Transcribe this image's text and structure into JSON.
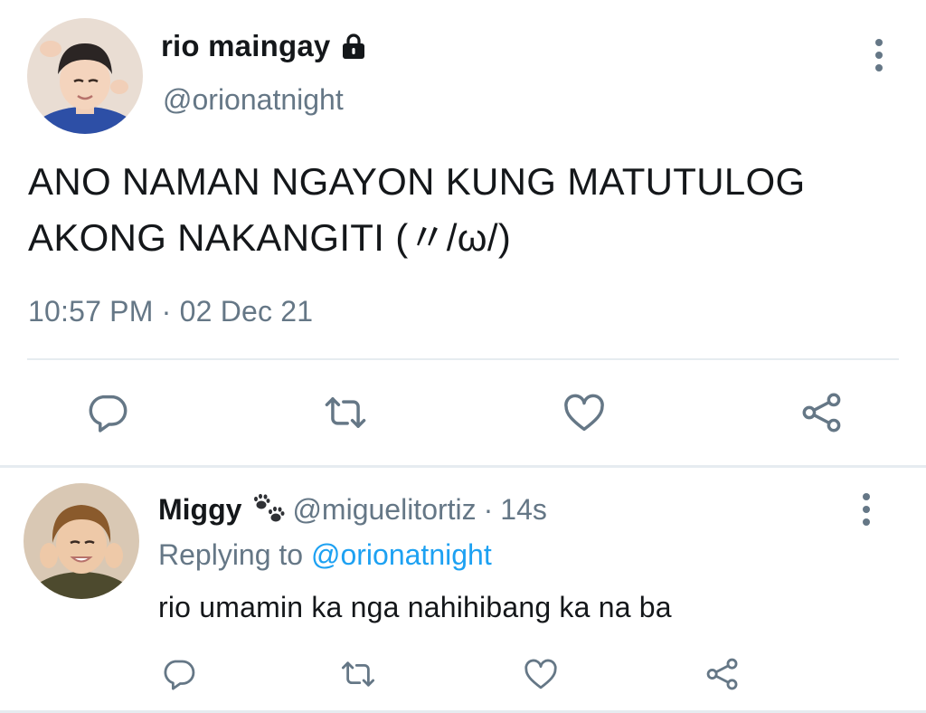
{
  "tweet": {
    "author_name": "rio maingay",
    "handle": "@orionatnight",
    "text": "ANO NAMAN NGAYON KUNG MATUTULOG AKONG NAKANGITI (〃/ω/)",
    "time": "10:57 PM",
    "separator": "·",
    "date": "02 Dec 21",
    "protected": true,
    "icons": [
      "lock-icon",
      "more-options-icon",
      "reply-icon",
      "retweet-icon",
      "like-icon",
      "share-icon"
    ]
  },
  "reply": {
    "author_name": "Miggy",
    "name_emoji": "paw-prints-icon",
    "handle": "@miguelitortiz",
    "separator": "·",
    "time": "14s",
    "replying_label": "Replying to",
    "replying_to": "@orionatnight",
    "text": "rio umamin ka nga nahihibang ka na ba",
    "icons": [
      "more-options-icon",
      "reply-icon",
      "retweet-icon",
      "like-icon",
      "share-icon"
    ]
  },
  "colors": {
    "text": "#14171a",
    "secondary": "#657786",
    "link": "#1da1f2",
    "icon": "#657786",
    "divider": "#e6ecf0"
  }
}
